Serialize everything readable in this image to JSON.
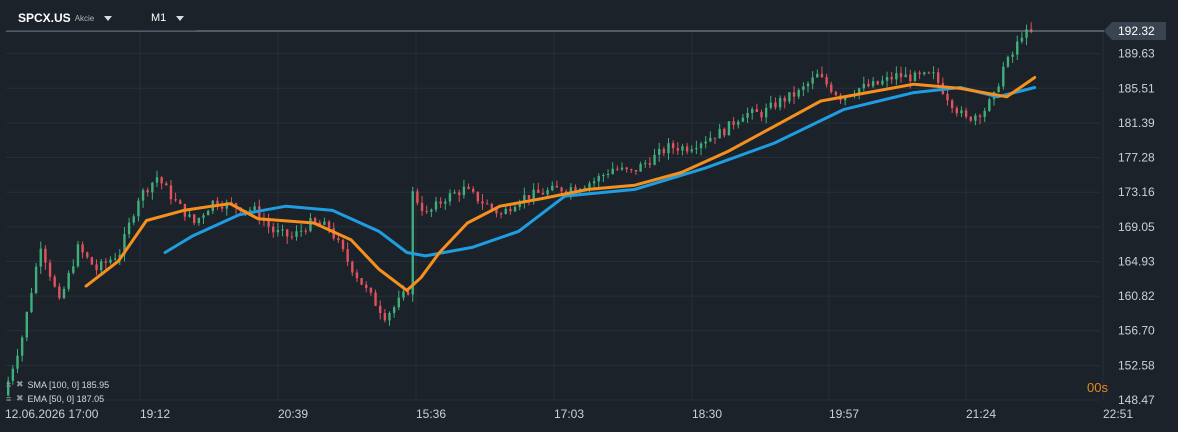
{
  "header": {
    "symbol": "SPCX.US",
    "instrument_type": "Akcie",
    "timeframe": "M1"
  },
  "colors": {
    "background": "#1b2229",
    "grid": "#26303a",
    "axis_text": "#c9d1d9",
    "candle_up": "#3fae7a",
    "candle_down": "#e0525c",
    "sma": "#1f9de0",
    "ema": "#f5901e",
    "price_label_bg": "#3a4450",
    "timer": "#e8891f"
  },
  "indicators": {
    "sma_label": "SMA [100, 0] 185.95",
    "ema_label": "EMA [50, 0] 187.05"
  },
  "timer": "00s",
  "chart_data": {
    "type": "candlestick",
    "ylim": [
      148.47,
      192.32
    ],
    "y_ticks": [
      "192.32",
      "189.63",
      "185.51",
      "181.39",
      "177.28",
      "173.16",
      "169.05",
      "164.93",
      "160.82",
      "156.70",
      "152.58",
      "148.47"
    ],
    "x_ticks": [
      "12.06.2026 17:00",
      "19:12",
      "20:39",
      "15:36",
      "17:03",
      "18:30",
      "19:57",
      "21:24",
      "22:51"
    ],
    "grid": true,
    "last_price": 192.32,
    "price_anchors": [
      [
        0,
        149.0
      ],
      [
        4,
        156.0
      ],
      [
        8,
        167.0
      ],
      [
        12,
        160.0
      ],
      [
        16,
        166.5
      ],
      [
        20,
        164.0
      ],
      [
        25,
        166.0
      ],
      [
        29,
        172.5
      ],
      [
        33,
        175.0
      ],
      [
        37,
        172.0
      ],
      [
        41,
        169.5
      ],
      [
        45,
        172.0
      ],
      [
        50,
        171.5
      ],
      [
        54,
        171.0
      ],
      [
        58,
        168.5
      ],
      [
        62,
        167.8
      ],
      [
        66,
        169.5
      ],
      [
        70,
        169.0
      ],
      [
        74,
        165.0
      ],
      [
        78,
        161.5
      ],
      [
        82,
        158.5
      ],
      [
        84,
        159.5
      ],
      [
        87,
        161.5
      ],
      [
        88,
        173.0
      ],
      [
        91,
        170.5
      ],
      [
        95,
        172.5
      ],
      [
        99,
        173.5
      ],
      [
        103,
        172.0
      ],
      [
        107,
        170.5
      ],
      [
        111,
        172.5
      ],
      [
        115,
        173.0
      ],
      [
        119,
        173.5
      ],
      [
        123,
        173.8
      ],
      [
        127,
        174.5
      ],
      [
        131,
        176.0
      ],
      [
        135,
        175.5
      ],
      [
        139,
        177.0
      ],
      [
        143,
        178.5
      ],
      [
        147,
        178.5
      ],
      [
        151,
        179.5
      ],
      [
        155,
        180.5
      ],
      [
        159,
        182.5
      ],
      [
        163,
        182.5
      ],
      [
        167,
        184.0
      ],
      [
        171,
        185.0
      ],
      [
        175,
        187.0
      ],
      [
        177,
        186.0
      ],
      [
        180,
        184.5
      ],
      [
        184,
        185.5
      ],
      [
        188,
        186.0
      ],
      [
        192,
        187.0
      ],
      [
        196,
        186.8
      ],
      [
        200,
        187.0
      ],
      [
        203,
        184.5
      ],
      [
        205,
        183.0
      ],
      [
        207,
        181.8
      ],
      [
        211,
        183.0
      ],
      [
        213,
        184.5
      ],
      [
        215,
        188.0
      ],
      [
        217,
        189.5
      ],
      [
        219,
        192.0
      ]
    ],
    "series": [
      {
        "name": "SMA [100, 0]",
        "points": [
          [
            34,
            166.0
          ],
          [
            40,
            168.0
          ],
          [
            50,
            170.5
          ],
          [
            60,
            171.5
          ],
          [
            70,
            171.0
          ],
          [
            80,
            168.5
          ],
          [
            86,
            166.0
          ],
          [
            90,
            165.6
          ],
          [
            100,
            166.6
          ],
          [
            110,
            168.5
          ],
          [
            120,
            172.7
          ],
          [
            135,
            173.5
          ],
          [
            150,
            176.0
          ],
          [
            165,
            179.0
          ],
          [
            180,
            183.0
          ],
          [
            195,
            185.0
          ],
          [
            205,
            185.6
          ],
          [
            213,
            184.5
          ],
          [
            221,
            185.6
          ]
        ]
      },
      {
        "name": "EMA [50, 0]",
        "points": [
          [
            17,
            162.0
          ],
          [
            24,
            165.0
          ],
          [
            30,
            169.8
          ],
          [
            38,
            171.0
          ],
          [
            44,
            171.5
          ],
          [
            48,
            171.8
          ],
          [
            54,
            170.0
          ],
          [
            66,
            169.5
          ],
          [
            74,
            167.5
          ],
          [
            80,
            164.0
          ],
          [
            86,
            161.5
          ],
          [
            89,
            163.0
          ],
          [
            93,
            166.0
          ],
          [
            99,
            169.5
          ],
          [
            106,
            171.5
          ],
          [
            115,
            172.4
          ],
          [
            125,
            173.5
          ],
          [
            135,
            174.0
          ],
          [
            145,
            175.5
          ],
          [
            155,
            178.0
          ],
          [
            165,
            181.0
          ],
          [
            175,
            184.0
          ],
          [
            185,
            185.0
          ],
          [
            195,
            186.0
          ],
          [
            205,
            185.5
          ],
          [
            215,
            184.5
          ],
          [
            221,
            186.8
          ]
        ]
      }
    ]
  }
}
